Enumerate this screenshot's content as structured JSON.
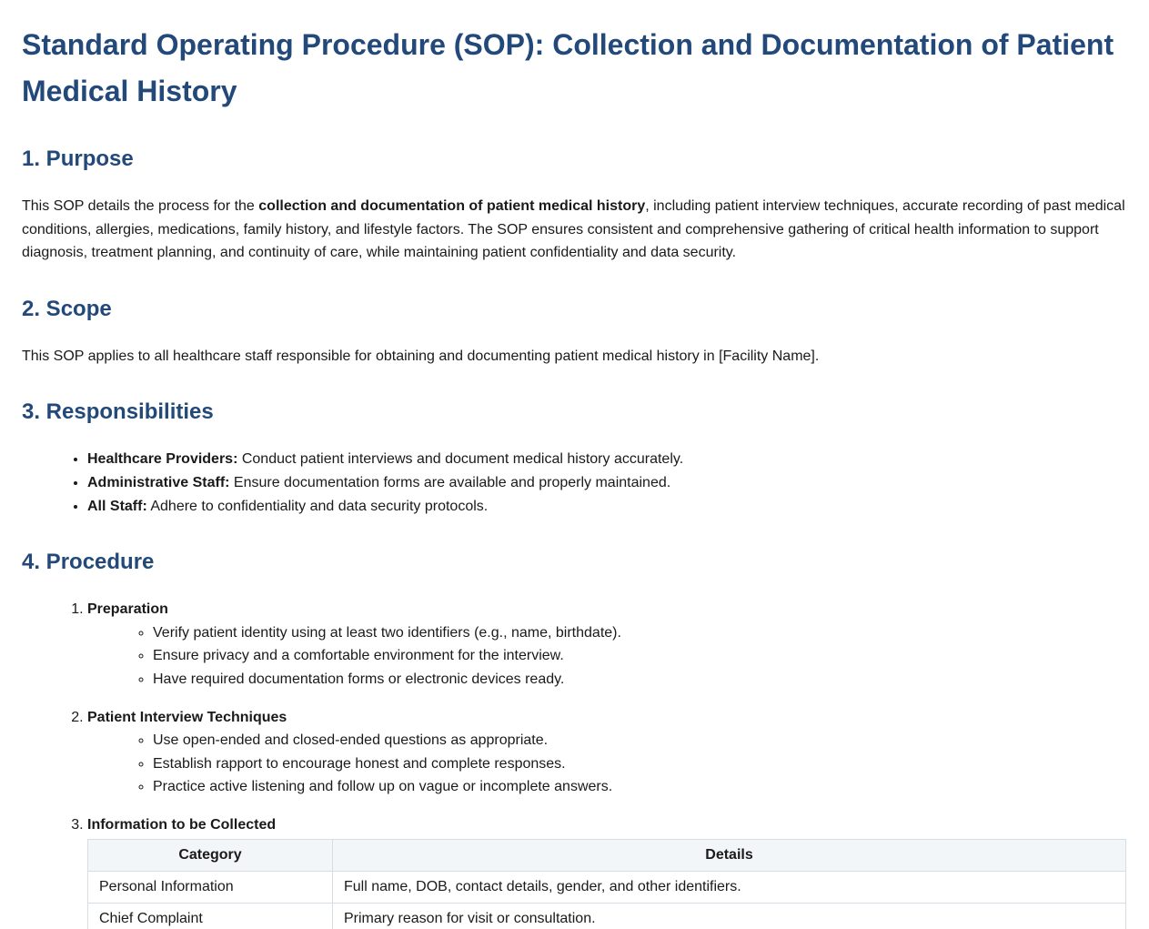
{
  "title": "Standard Operating Procedure (SOP): Collection and Documentation of Patient Medical History",
  "purpose": {
    "heading": "1. Purpose",
    "text_before": "This SOP details the process for the ",
    "text_bold": "collection and documentation of patient medical history",
    "text_after": ", including patient interview techniques, accurate recording of past medical conditions, allergies, medications, family history, and lifestyle factors. The SOP ensures consistent and comprehensive gathering of critical health information to support diagnosis, treatment planning, and continuity of care, while maintaining patient confidentiality and data security."
  },
  "scope": {
    "heading": "2. Scope",
    "text": "This SOP applies to all healthcare staff responsible for obtaining and documenting patient medical history in [Facility Name]."
  },
  "responsibilities": {
    "heading": "3. Responsibilities",
    "items": [
      {
        "role": "Healthcare Providers:",
        "text": " Conduct patient interviews and document medical history accurately."
      },
      {
        "role": "Administrative Staff:",
        "text": " Ensure documentation forms are available and properly maintained."
      },
      {
        "role": "All Staff:",
        "text": " Adhere to confidentiality and data security protocols."
      }
    ]
  },
  "procedure": {
    "heading": "4. Procedure",
    "steps": [
      {
        "title": "Preparation",
        "items": [
          "Verify patient identity using at least two identifiers (e.g., name, birthdate).",
          "Ensure privacy and a comfortable environment for the interview.",
          "Have required documentation forms or electronic devices ready."
        ]
      },
      {
        "title": "Patient Interview Techniques",
        "items": [
          "Use open-ended and closed-ended questions as appropriate.",
          "Establish rapport to encourage honest and complete responses.",
          "Practice active listening and follow up on vague or incomplete answers."
        ]
      },
      {
        "title": "Information to be Collected",
        "table": {
          "headers": [
            "Category",
            "Details"
          ],
          "rows": [
            [
              "Personal Information",
              "Full name, DOB, contact details, gender, and other identifiers."
            ],
            [
              "Chief Complaint",
              "Primary reason for visit or consultation."
            ],
            [
              "",
              ""
            ]
          ]
        }
      }
    ]
  }
}
